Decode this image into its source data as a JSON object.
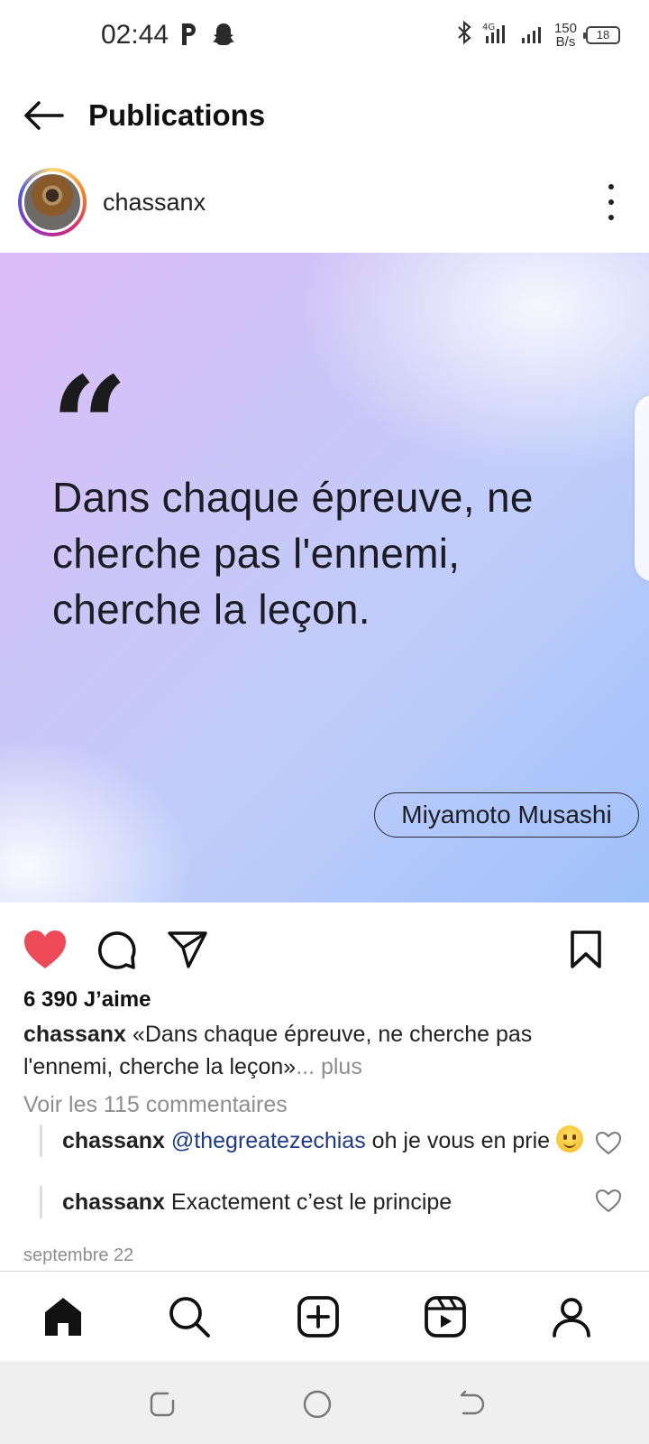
{
  "status_bar": {
    "time": "02:44",
    "left_icons": [
      "parking-icon",
      "snapchat-icon"
    ],
    "network_speed_value": "150",
    "network_speed_unit": "B/s",
    "battery": "18",
    "right_icons": [
      "bluetooth-icon",
      "signal-4g-icon",
      "signal-icon",
      "battery-icon"
    ]
  },
  "header": {
    "title": "Publications"
  },
  "post": {
    "username": "chassanx",
    "image": {
      "quote_mark": "“",
      "quote_line1": "Dans chaque épreuve, ne",
      "quote_line2": "cherche pas l'ennemi,",
      "quote_line3": "cherche la leçon.",
      "author": "Miyamoto Musashi"
    },
    "liked": true,
    "likes": "6 390 J’aime",
    "caption_user": "chassanx",
    "caption_text": "«Dans chaque épreuve, ne cherche pas l'ennemi, cherche la leçon»",
    "caption_more": "... plus",
    "view_comments": "Voir les 115 commentaires",
    "comments": [
      {
        "user": "chassanx",
        "mention": "@thegreatezechias",
        "text": "oh je vous en prie"
      },
      {
        "user": "chassanx",
        "mention": "",
        "text": "Exactement c’est le principe"
      }
    ],
    "date": "septembre 22"
  },
  "colors": {
    "like_red": "#ed4956",
    "muted_text": "#8e8e8e",
    "mention_blue": "#1e3a8a"
  },
  "bottom_nav": [
    "home-icon",
    "search-icon",
    "create-post-icon",
    "reels-icon",
    "profile-icon"
  ],
  "system_nav": [
    "recents-icon",
    "home-circle-icon",
    "back-icon"
  ]
}
